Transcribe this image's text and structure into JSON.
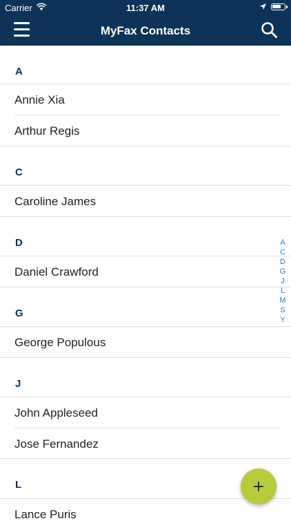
{
  "status_bar": {
    "carrier": "Carrier",
    "time": "11:37 AM"
  },
  "nav": {
    "title": "MyFax Contacts",
    "menu_icon": "hamburger-menu-icon",
    "search_icon": "search-icon"
  },
  "sections": [
    {
      "letter": "A",
      "contacts": [
        "Annie Xia",
        "Arthur Regis"
      ]
    },
    {
      "letter": "C",
      "contacts": [
        "Caroline James"
      ]
    },
    {
      "letter": "D",
      "contacts": [
        "Daniel Crawford"
      ]
    },
    {
      "letter": "G",
      "contacts": [
        "George Populous"
      ]
    },
    {
      "letter": "J",
      "contacts": [
        "John Appleseed",
        "Jose Fernandez"
      ]
    },
    {
      "letter": "L",
      "contacts": [
        "Lance Puris"
      ]
    }
  ],
  "index_letters": [
    "A",
    "C",
    "D",
    "G",
    "J",
    "L",
    "M",
    "S",
    "Y"
  ],
  "fab": {
    "label": "+",
    "icon": "plus-icon"
  },
  "colors": {
    "nav_bg": "#0d3358",
    "section_text": "#0d3358",
    "index_text": "#1f84d6",
    "fab_bg": "#b7ca3b"
  }
}
